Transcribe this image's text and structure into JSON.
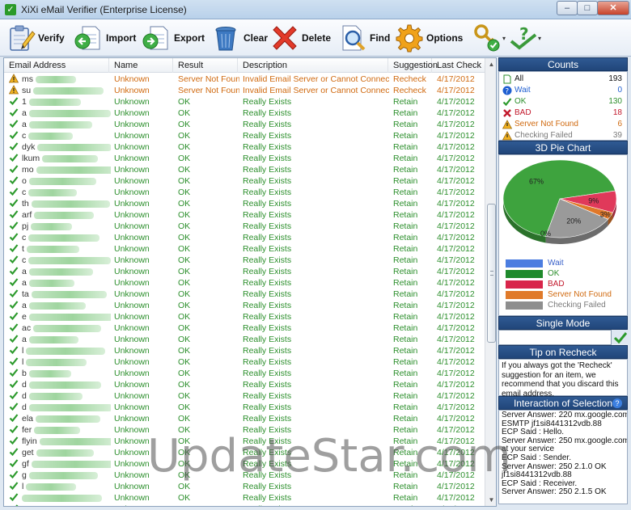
{
  "window": {
    "title": "XiXi eMail Verifier (Enterprise License)",
    "minimize": "–",
    "maximize": "□",
    "close": "✕"
  },
  "toolbar": {
    "verify": "Verify",
    "import": "Import",
    "export": "Export",
    "clear": "Clear",
    "delete": "Delete",
    "find": "Find",
    "options": "Options",
    "dropdown": "▾"
  },
  "grid": {
    "columns": [
      "Email Address",
      "Name",
      "Result",
      "Description",
      "Suggestion",
      "Last Check"
    ],
    "rows": [
      {
        "status": "warn",
        "email": "ms",
        "name": "Unknown",
        "result": "Server Not Found",
        "desc": "Invalid Email Server or Cannot Connect to It",
        "sugg": "Recheck",
        "date": "4/17/2012"
      },
      {
        "status": "warn",
        "email": "su",
        "name": "Unknown",
        "result": "Server Not Found",
        "desc": "Invalid Email Server or Cannot Connect to It",
        "sugg": "Recheck",
        "date": "4/17/2012"
      },
      {
        "status": "ok",
        "email": "1",
        "name": "Unknown",
        "result": "OK",
        "desc": "Really Exists",
        "sugg": "Retain",
        "date": "4/17/2012"
      },
      {
        "status": "ok",
        "email": "a",
        "name": "Unknown",
        "result": "OK",
        "desc": "Really Exists",
        "sugg": "Retain",
        "date": "4/17/2012"
      },
      {
        "status": "ok",
        "email": "a",
        "name": "Unknown",
        "result": "OK",
        "desc": "Really Exists",
        "sugg": "Retain",
        "date": "4/17/2012"
      },
      {
        "status": "ok",
        "email": "c",
        "name": "Unknown",
        "result": "OK",
        "desc": "Really Exists",
        "sugg": "Retain",
        "date": "4/17/2012"
      },
      {
        "status": "ok",
        "email": "dyk",
        "name": "Unknown",
        "result": "OK",
        "desc": "Really Exists",
        "sugg": "Retain",
        "date": "4/17/2012"
      },
      {
        "status": "ok",
        "email": "lkum",
        "name": "Unknown",
        "result": "OK",
        "desc": "Really Exists",
        "sugg": "Retain",
        "date": "4/17/2012"
      },
      {
        "status": "ok",
        "email": "mo",
        "name": "Unknown",
        "result": "OK",
        "desc": "Really Exists",
        "sugg": "Retain",
        "date": "4/17/2012"
      },
      {
        "status": "ok",
        "email": "o",
        "name": "Unknown",
        "result": "OK",
        "desc": "Really Exists",
        "sugg": "Retain",
        "date": "4/17/2012"
      },
      {
        "status": "ok",
        "email": "c",
        "name": "Unknown",
        "result": "OK",
        "desc": "Really Exists",
        "sugg": "Retain",
        "date": "4/17/2012"
      },
      {
        "status": "ok",
        "email": "th",
        "name": "Unknown",
        "result": "OK",
        "desc": "Really Exists",
        "sugg": "Retain",
        "date": "4/17/2012"
      },
      {
        "status": "ok",
        "email": "arf",
        "name": "Unknown",
        "result": "OK",
        "desc": "Really Exists",
        "sugg": "Retain",
        "date": "4/17/2012"
      },
      {
        "status": "ok",
        "email": "pj",
        "name": "Unknown",
        "result": "OK",
        "desc": "Really Exists",
        "sugg": "Retain",
        "date": "4/17/2012"
      },
      {
        "status": "ok",
        "email": "c",
        "name": "Unknown",
        "result": "OK",
        "desc": "Really Exists",
        "sugg": "Retain",
        "date": "4/17/2012"
      },
      {
        "status": "ok",
        "email": "t",
        "name": "Unknown",
        "result": "OK",
        "desc": "Really Exists",
        "sugg": "Retain",
        "date": "4/17/2012"
      },
      {
        "status": "ok",
        "email": "c",
        "name": "Unknown",
        "result": "OK",
        "desc": "Really Exists",
        "sugg": "Retain",
        "date": "4/17/2012"
      },
      {
        "status": "ok",
        "email": "a",
        "name": "Unknown",
        "result": "OK",
        "desc": "Really Exists",
        "sugg": "Retain",
        "date": "4/17/2012"
      },
      {
        "status": "ok",
        "email": "a",
        "name": "Unknown",
        "result": "OK",
        "desc": "Really Exists",
        "sugg": "Retain",
        "date": "4/17/2012"
      },
      {
        "status": "ok",
        "email": "ta",
        "name": "Unknown",
        "result": "OK",
        "desc": "Really Exists",
        "sugg": "Retain",
        "date": "4/17/2012"
      },
      {
        "status": "ok",
        "email": "a",
        "name": "Unknown",
        "result": "OK",
        "desc": "Really Exists",
        "sugg": "Retain",
        "date": "4/17/2012"
      },
      {
        "status": "ok",
        "email": "e",
        "name": "Unknown",
        "result": "OK",
        "desc": "Really Exists",
        "sugg": "Retain",
        "date": "4/17/2012"
      },
      {
        "status": "ok",
        "email": "ac",
        "name": "Unknown",
        "result": "OK",
        "desc": "Really Exists",
        "sugg": "Retain",
        "date": "4/17/2012"
      },
      {
        "status": "ok",
        "email": "a",
        "name": "Unknown",
        "result": "OK",
        "desc": "Really Exists",
        "sugg": "Retain",
        "date": "4/17/2012"
      },
      {
        "status": "ok",
        "email": "l",
        "name": "Unknown",
        "result": "OK",
        "desc": "Really Exists",
        "sugg": "Retain",
        "date": "4/17/2012"
      },
      {
        "status": "ok",
        "email": "l",
        "name": "Unknown",
        "result": "OK",
        "desc": "Really Exists",
        "sugg": "Retain",
        "date": "4/17/2012"
      },
      {
        "status": "ok",
        "email": "b",
        "name": "Unknown",
        "result": "OK",
        "desc": "Really Exists",
        "sugg": "Retain",
        "date": "4/17/2012"
      },
      {
        "status": "ok",
        "email": "d",
        "name": "Unknown",
        "result": "OK",
        "desc": "Really Exists",
        "sugg": "Retain",
        "date": "4/17/2012"
      },
      {
        "status": "ok",
        "email": "d",
        "name": "Unknown",
        "result": "OK",
        "desc": "Really Exists",
        "sugg": "Retain",
        "date": "4/17/2012"
      },
      {
        "status": "ok",
        "email": "d",
        "name": "Unknown",
        "result": "OK",
        "desc": "Really Exists",
        "sugg": "Retain",
        "date": "4/17/2012"
      },
      {
        "status": "ok",
        "email": "ela",
        "name": "Unknown",
        "result": "OK",
        "desc": "Really Exists",
        "sugg": "Retain",
        "date": "4/17/2012"
      },
      {
        "status": "ok",
        "email": "fer",
        "name": "Unknown",
        "result": "OK",
        "desc": "Really Exists",
        "sugg": "Retain",
        "date": "4/17/2012"
      },
      {
        "status": "ok",
        "email": "flyin",
        "name": "Unknown",
        "result": "OK",
        "desc": "Really Exists",
        "sugg": "Retain",
        "date": "4/17/2012"
      },
      {
        "status": "ok",
        "email": "get",
        "name": "Unknown",
        "result": "OK",
        "desc": "Really Exists",
        "sugg": "Retain",
        "date": "4/17/2012"
      },
      {
        "status": "ok",
        "email": "gf",
        "name": "Unknown",
        "result": "OK",
        "desc": "Really Exists",
        "sugg": "Retain",
        "date": "4/17/2012"
      },
      {
        "status": "ok",
        "email": "g",
        "name": "Unknown",
        "result": "OK",
        "desc": "Really Exists",
        "sugg": "Retain",
        "date": "4/17/2012"
      },
      {
        "status": "ok",
        "email": "l",
        "name": "Unknown",
        "result": "OK",
        "desc": "Really Exists",
        "sugg": "Retain",
        "date": "4/17/2012"
      },
      {
        "status": "ok",
        "email": "",
        "name": "Unknown",
        "result": "OK",
        "desc": "Really Exists",
        "sugg": "Retain",
        "date": "4/17/2012"
      },
      {
        "status": "ok",
        "email": "",
        "name": "Unknown",
        "result": "OK",
        "desc": "Really Exists",
        "sugg": "Retain",
        "date": "4/17/2012"
      }
    ]
  },
  "side": {
    "counts_title": "Counts",
    "counts": [
      {
        "label": "All",
        "value": "193",
        "color": "#111111",
        "icon": "page-icon"
      },
      {
        "label": "Wait",
        "value": "0",
        "color": "#1f5fd1",
        "icon": "question-icon"
      },
      {
        "label": "OK",
        "value": "130",
        "color": "#2c8f2c",
        "icon": "check-icon"
      },
      {
        "label": "BAD",
        "value": "18",
        "color": "#c2182b",
        "icon": "cross-icon"
      },
      {
        "label": "Server Not Found",
        "value": "6",
        "color": "#d06a10",
        "icon": "warning-icon"
      },
      {
        "label": "Checking Failed",
        "value": "39",
        "color": "#7a7a7a",
        "icon": "warning-grey-icon"
      }
    ],
    "pie_title": "3D Pie Chart",
    "single_title": "Single Mode",
    "single_placeholder": "",
    "tip_title": "Tip on Recheck",
    "tip_text": "If you always got the 'Recheck' suggestion for an item, we recommend that you discard this email address.",
    "interaction_title": "Interaction of Selection",
    "interaction_help": "?",
    "log": [
      "Server Answer: 220 mx.google.com",
      "ESMTP jf1si8441312vdb.88",
      "ECP Said : Hello.",
      "Server Answer: 250 mx.google.com",
      "at your service",
      "ECP Said : Sender.",
      "Server Answer: 250 2.1.0 OK",
      "jf1si8441312vdb.88",
      "ECP Said : Receiver.",
      "Server Answer: 250 2.1.5 OK"
    ]
  },
  "chart_data": {
    "type": "pie",
    "slices": [
      {
        "label": "Wait",
        "value": 0,
        "pct_label": "0%",
        "color": "#4b7de0"
      },
      {
        "label": "OK",
        "value": 67,
        "pct_label": "67%",
        "color": "#3ea33e"
      },
      {
        "label": "BAD",
        "value": 9,
        "pct_label": "9%",
        "color": "#e0395a"
      },
      {
        "label": "Server Not Found",
        "value": 3,
        "pct_label": "3%",
        "color": "#e0782a"
      },
      {
        "label": "Checking Failed",
        "value": 20,
        "pct_label": "20%",
        "color": "#9a9a9a"
      }
    ],
    "legend": [
      {
        "label": "Wait",
        "color": "#4b7de0",
        "text_color": "#3a62c9"
      },
      {
        "label": "OK",
        "color": "#1f8a2c",
        "text_color": "#2c8f2c"
      },
      {
        "label": "BAD",
        "color": "#d8254a",
        "text_color": "#c2182b"
      },
      {
        "label": "Server Not Found",
        "color": "#e07a2a",
        "text_color": "#d06a10"
      },
      {
        "label": "Checking Failed",
        "color": "#8e8e8e",
        "text_color": "#7a7a7a"
      }
    ]
  },
  "watermark": "UpdateStar.com"
}
